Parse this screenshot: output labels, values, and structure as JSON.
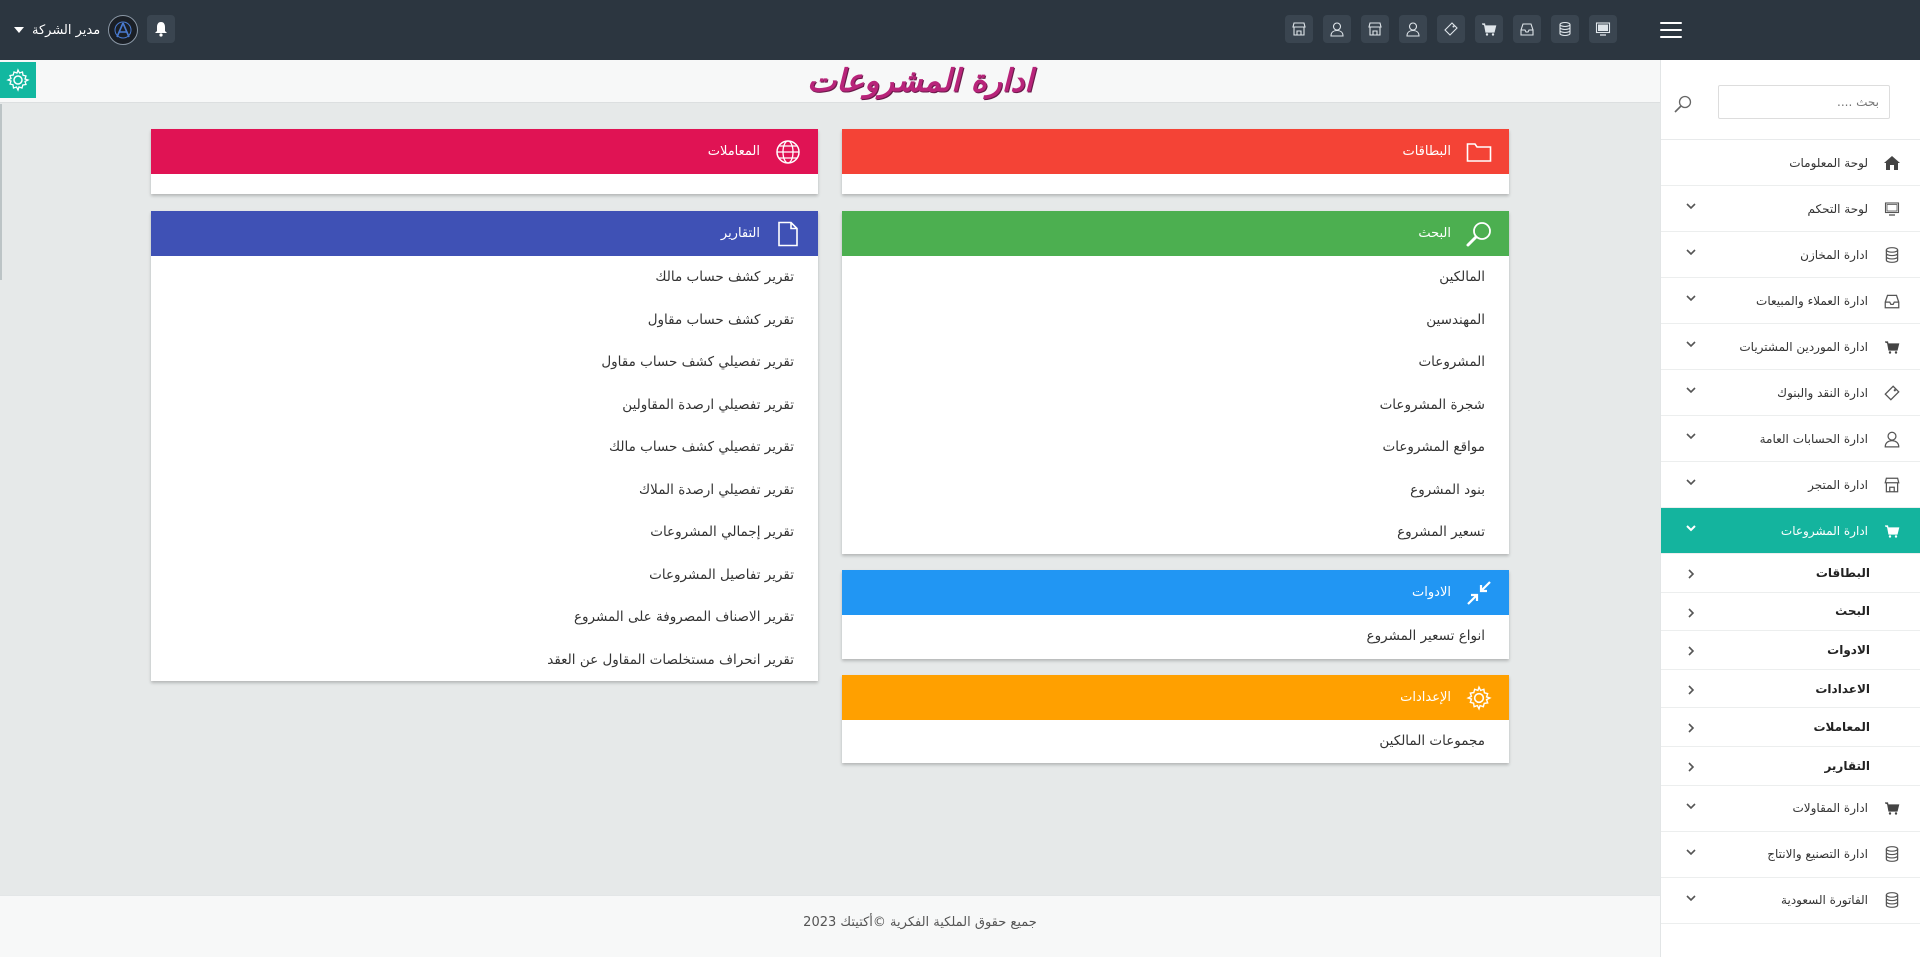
{
  "topbar": {
    "user_name": "مدير الشركة",
    "icons": [
      "monitor-icon",
      "database-icon",
      "inbox-icon",
      "cart-icon",
      "tag-icon",
      "user-icon",
      "store-icon",
      "user-icon",
      "store-icon"
    ]
  },
  "page": {
    "title": "ادارة المشروعات"
  },
  "cards": {
    "cards_section": {
      "title": "البطاقات",
      "color": "#f44336"
    },
    "transactions": {
      "title": "المعاملات",
      "color": "#e01354"
    },
    "search": {
      "title": "البحث",
      "color": "#4caf50",
      "items": [
        "المالكين",
        "المهندسين",
        "المشروعات",
        "شجرة المشروعات",
        "مواقع المشروعات",
        "بنود المشروع",
        "تسعير المشروع"
      ]
    },
    "reports": {
      "title": "التقارير",
      "color": "#3f51b5",
      "items": [
        "تقرير كشف حساب مالك",
        "تقرير كشف حساب مقاول",
        "تقرير تفصيلي كشف حساب مقاول",
        "تقرير تفصيلي ارصدة المقاولين",
        "تقرير تفصيلي كشف حساب مالك",
        "تقرير تفصيلي ارصدة الملاك",
        "تقرير إجمالي المشروعات",
        "تقرير تفاصيل المشروعات",
        "تقرير الاصناف المصروفة على المشروع",
        "تقرير انحراف مستخلصات المقاول عن العقد"
      ]
    },
    "tools": {
      "title": "الادوات",
      "color": "#2196f3",
      "items": [
        "انواع تسعير المشروع"
      ]
    },
    "settings": {
      "title": "الإعدادات",
      "color": "#ffa000",
      "items": [
        "مجموعات المالكين"
      ]
    }
  },
  "sidebar": {
    "search_placeholder": "بحث ....",
    "items": [
      {
        "label": "لوحة المعلومات",
        "icon": "home-icon"
      },
      {
        "label": "لوحة التحكم",
        "icon": "monitor-icon"
      },
      {
        "label": "ادارة المخازن",
        "icon": "database-icon"
      },
      {
        "label": "ادارة العملاء والمبيعات",
        "icon": "inbox-icon"
      },
      {
        "label": "ادارة الموردين المشتريات",
        "icon": "cart-icon"
      },
      {
        "label": "ادارة النقد والبنوك",
        "icon": "tag-icon"
      },
      {
        "label": "ادارة الحسابات العامة",
        "icon": "user-icon"
      },
      {
        "label": "ادارة المتجر",
        "icon": "store-icon"
      },
      {
        "label": "ادارة المشروعات",
        "icon": "cart-icon"
      },
      {
        "label": "ادارة المقاولات",
        "icon": "cart-icon"
      },
      {
        "label": "ادارة التصنيع والانتاج",
        "icon": "database-icon"
      },
      {
        "label": "الفاتورة السعودية",
        "icon": "database-icon"
      }
    ],
    "sub_items": [
      "البطاقات",
      "البحث",
      "الادوات",
      "الاعدادات",
      "المعاملات",
      "التقارير"
    ],
    "active_color": "#14b49e"
  },
  "footer": {
    "text": "جميع حقوق الملكية الفكرية ©أكتيتك 2023"
  }
}
